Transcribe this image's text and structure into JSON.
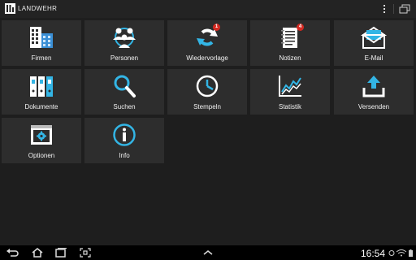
{
  "actionbar": {
    "title": "LANDWEHR"
  },
  "tiles": [
    {
      "label": "Firmen",
      "icon": "buildings-icon"
    },
    {
      "label": "Personen",
      "icon": "people-group-icon"
    },
    {
      "label": "Wiedervorlage",
      "icon": "refresh-arrows-icon",
      "badge": "1"
    },
    {
      "label": "Notizen",
      "icon": "notepad-icon",
      "badge": "4"
    },
    {
      "label": "E-Mail",
      "icon": "envelope-icon"
    },
    {
      "label": "Dokumente",
      "icon": "binders-icon"
    },
    {
      "label": "Suchen",
      "icon": "magnifier-icon"
    },
    {
      "label": "Stempeln",
      "icon": "clock-icon"
    },
    {
      "label": "Statistik",
      "icon": "line-chart-icon"
    },
    {
      "label": "Versenden",
      "icon": "upload-tray-icon"
    },
    {
      "label": "Optionen",
      "icon": "settings-window-icon"
    },
    {
      "label": "Info",
      "icon": "info-icon"
    }
  ],
  "statusbar": {
    "time": "16:54"
  },
  "colors": {
    "tile": "#2d2d2d",
    "background": "#1e1e1e",
    "accent": "#33b5e5",
    "badge": "#d42a22"
  }
}
